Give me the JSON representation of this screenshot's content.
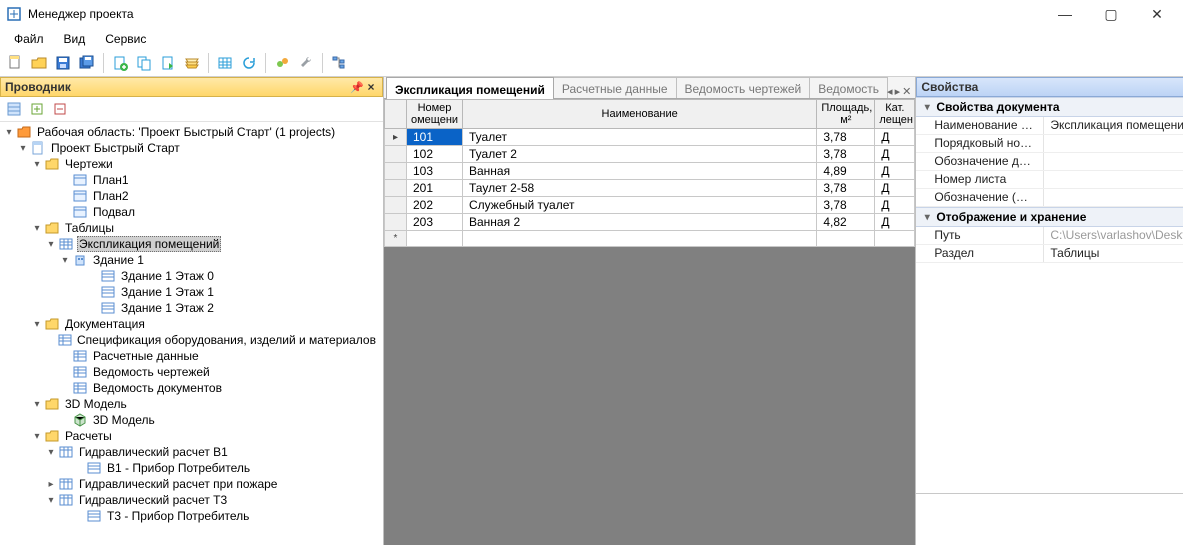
{
  "window": {
    "title": "Менеджер проекта"
  },
  "menu": {
    "file": "Файл",
    "view": "Вид",
    "service": "Сервис"
  },
  "explorer": {
    "title": "Проводник",
    "pin": "📌",
    "root": "Рабочая область: 'Проект Быстрый Старт' (1 projects)",
    "project": "Проект Быстрый Старт",
    "drawings": "Чертежи",
    "plan1": "План1",
    "plan2": "План2",
    "podval": "Подвал",
    "tables": "Таблицы",
    "expl": "Экспликация помещений",
    "bldg1": "Здание 1",
    "fl0": "Здание 1 Этаж 0",
    "fl1": "Здание 1 Этаж 1",
    "fl2": "Здание 1 Этаж 2",
    "docs": "Документация",
    "spec": "Спецификация оборудования, изделий и материалов",
    "calcdata": "Расчетные данные",
    "ved_ch": "Ведомость чертежей",
    "ved_doc": "Ведомость документов",
    "model3d_f": "3D Модель",
    "model3d": "3D Модель",
    "calcs": "Расчеты",
    "hv1": "Гидравлический расчет В1",
    "hv1s": "В1 - Прибор Потребитель",
    "hfire": "Гидравлический расчет при пожаре",
    "ht3": "Гидравлический расчет Т3",
    "ht3s": "Т3 - Прибор Потребитель"
  },
  "tabs": {
    "active": "Экспликация помещений",
    "t2": "Расчетные данные",
    "t3": "Ведомость чертежей",
    "t4": "Ведомость"
  },
  "gridheaders": {
    "num": "Номер омещени",
    "name": "Наименование",
    "area": "Площадь, м²",
    "cat": "Кат. лещен"
  },
  "rows": [
    {
      "n": "101",
      "name": "Туалет",
      "a": "3,78",
      "c": "Д"
    },
    {
      "n": "102",
      "name": "Туалет 2",
      "a": "3,78",
      "c": "Д"
    },
    {
      "n": "103",
      "name": "Ванная",
      "a": "4,89",
      "c": "Д"
    },
    {
      "n": "201",
      "name": "Таулет 2-58",
      "a": "3,78",
      "c": "Д"
    },
    {
      "n": "202",
      "name": "Служебный туалет",
      "a": "3,78",
      "c": "Д"
    },
    {
      "n": "203",
      "name": "Ванная 2",
      "a": "4,82",
      "c": "Д"
    }
  ],
  "props": {
    "title": "Свойства",
    "cat1": "Свойства документа",
    "p_name_l": "Наименование доку...",
    "p_name_v": "Экспликация помещений",
    "p_ord_l": "Порядковый номер...",
    "p_obd_l": "Обозначение докуме...",
    "p_sheet_l": "Номер листа",
    "p_cipher_l": "Обозначение (шифр)...",
    "cat2": "Отображение и хранение",
    "p_path_l": "Путь",
    "p_path_v": "C:\\Users\\varlashov\\Desktop\\Проект Быстры",
    "p_sect_l": "Раздел",
    "p_sect_v": "Таблицы"
  }
}
